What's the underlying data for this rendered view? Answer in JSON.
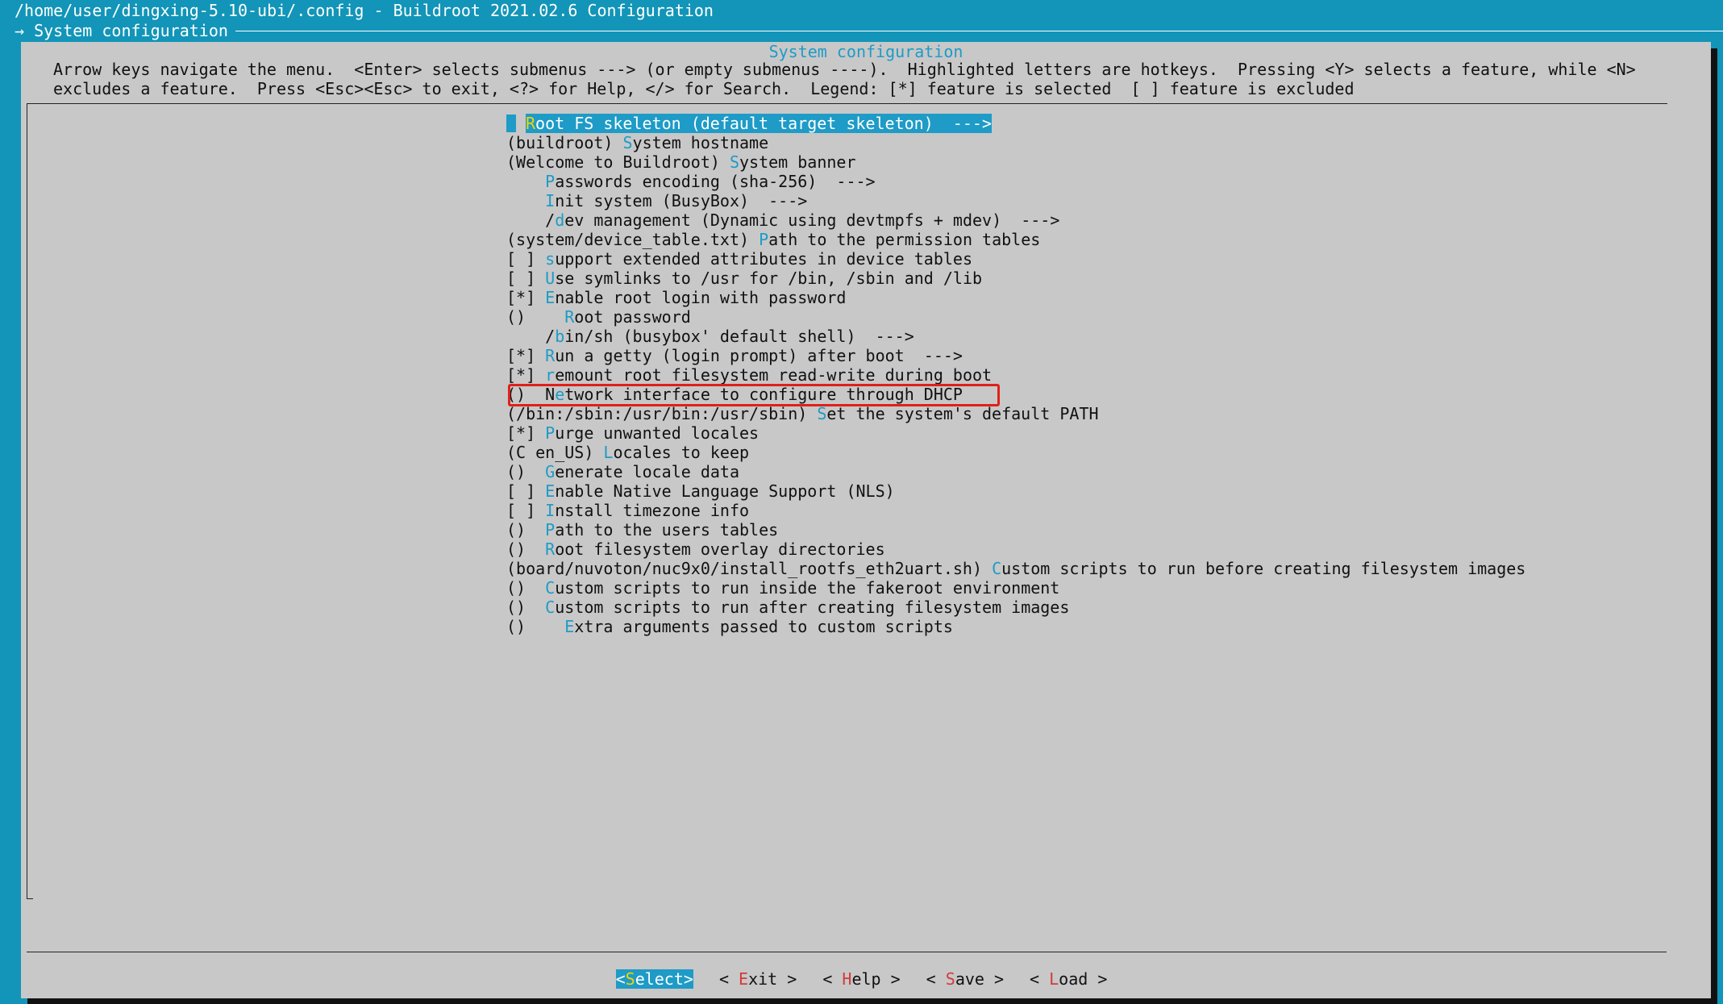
{
  "window": {
    "title": "/home/user/dingxing-5.10-ubi/.config - Buildroot 2021.02.6 Configuration",
    "breadcrumb": "→ System configuration "
  },
  "dialog": {
    "title": "System configuration",
    "instructions_line1": "Arrow keys navigate the menu.  <Enter> selects submenus ---> (or empty submenus ----).  Highlighted letters are hotkeys.  Pressing <Y> selects a feature, while <N>",
    "instructions_line2": "excludes a feature.  Press <Esc><Esc> to exit, <?> for Help, </> for Search.  Legend: [*] feature is selected  [ ] feature is excluded"
  },
  "menu": {
    "items": [
      {
        "pre": "",
        "hk": "R",
        "post": "oot FS skeleton (default target skeleton)  --->",
        "selected": true
      },
      {
        "pre": "(buildroot) ",
        "hk": "S",
        "post": "ystem hostname"
      },
      {
        "pre": "(Welcome to Buildroot) ",
        "hk": "S",
        "post": "ystem banner"
      },
      {
        "pre": "    ",
        "hk": "P",
        "post": "asswords encoding (sha-256)  --->"
      },
      {
        "pre": "    ",
        "hk": "I",
        "post": "nit system (BusyBox)  --->"
      },
      {
        "pre": "    /",
        "hk": "d",
        "post": "ev management (Dynamic using devtmpfs + mdev)  --->"
      },
      {
        "pre": "(system/device_table.txt) ",
        "hk": "P",
        "post": "ath to the permission tables"
      },
      {
        "pre": "[ ] ",
        "hk": "s",
        "post": "upport extended attributes in device tables"
      },
      {
        "pre": "[ ] ",
        "hk": "U",
        "post": "se symlinks to /usr for /bin, /sbin and /lib"
      },
      {
        "pre": "[*] ",
        "hk": "E",
        "post": "nable root login with password"
      },
      {
        "pre": "()    ",
        "hk": "R",
        "post": "oot password"
      },
      {
        "pre": "    /",
        "hk": "b",
        "post": "in/sh (busybox' default shell)  --->"
      },
      {
        "pre": "[*] ",
        "hk": "R",
        "post": "un a getty (login prompt) after boot  --->"
      },
      {
        "pre": "[*] ",
        "hk": "r",
        "post": "emount root filesystem read-write during boot"
      },
      {
        "pre": "()  N",
        "hk": "e",
        "post": "twork interface to configure through DHCP"
      },
      {
        "pre": "(/bin:/sbin:/usr/bin:/usr/sbin) ",
        "hk": "S",
        "post": "et the system's default PATH"
      },
      {
        "pre": "[*] ",
        "hk": "P",
        "post": "urge unwanted locales"
      },
      {
        "pre": "(C en_US) ",
        "hk": "L",
        "post": "ocales to keep"
      },
      {
        "pre": "()  ",
        "hk": "G",
        "post": "enerate locale data"
      },
      {
        "pre": "[ ] ",
        "hk": "E",
        "post": "nable Native Language Support (NLS)"
      },
      {
        "pre": "[ ] ",
        "hk": "I",
        "post": "nstall timezone info"
      },
      {
        "pre": "()  ",
        "hk": "P",
        "post": "ath to the users tables"
      },
      {
        "pre": "()  ",
        "hk": "R",
        "post": "oot filesystem overlay directories"
      },
      {
        "pre": "(board/nuvoton/nuc9x0/install_rootfs_eth2uart.sh) ",
        "hk": "C",
        "post": "ustom scripts to run before creating filesystem images"
      },
      {
        "pre": "()  ",
        "hk": "C",
        "post": "ustom scripts to run inside the fakeroot environment"
      },
      {
        "pre": "()  ",
        "hk": "C",
        "post": "ustom scripts to run after creating filesystem images"
      },
      {
        "pre": "()    ",
        "hk": "E",
        "post": "xtra arguments passed to custom scripts"
      }
    ]
  },
  "buttons": [
    {
      "open": "<",
      "hk": "S",
      "rest": "elect",
      "close": ">",
      "active": true
    },
    {
      "open": "< ",
      "hk": "E",
      "rest": "xit",
      "close": " >"
    },
    {
      "open": "< ",
      "hk": "H",
      "rest": "elp",
      "close": " >"
    },
    {
      "open": "< ",
      "hk": "S",
      "rest": "ave",
      "close": " >"
    },
    {
      "open": "< ",
      "hk": "L",
      "rest": "oad",
      "close": " >"
    }
  ],
  "colors": {
    "background": "#1295b8",
    "dialog": "#c8c8c8",
    "hotkey": "#1e9bc7",
    "button_hotkey": "#d23b3b",
    "highlight_box": "#e0201a"
  }
}
